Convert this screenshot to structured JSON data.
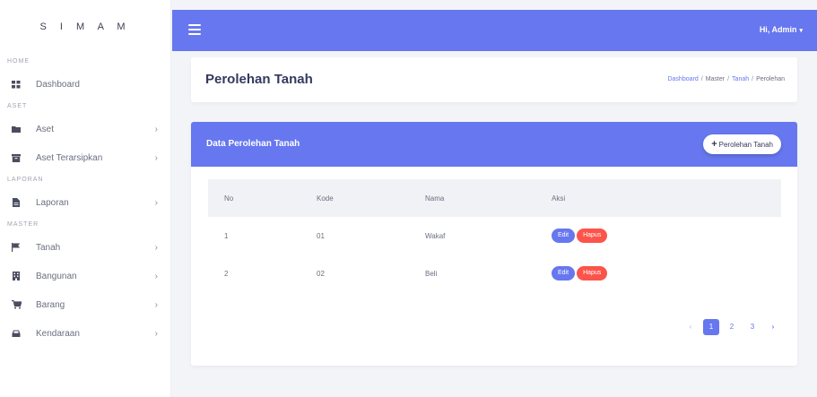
{
  "brand": "S I M A M",
  "topbar": {
    "user_label": "Hi, Admin",
    "caret": "▾"
  },
  "sidebar": {
    "sections": [
      "HOME",
      "ASET",
      "LAPORAN",
      "MASTER"
    ],
    "items": [
      {
        "label": "Dashboard",
        "icon": "dashboard-icon"
      },
      {
        "label": "Aset",
        "icon": "folder-icon"
      },
      {
        "label": "Aset Terarsipkan",
        "icon": "archive-icon"
      },
      {
        "label": "Laporan",
        "icon": "file-icon"
      },
      {
        "label": "Tanah",
        "icon": "flag-icon"
      },
      {
        "label": "Bangunan",
        "icon": "building-icon"
      },
      {
        "label": "Barang",
        "icon": "cart-icon"
      },
      {
        "label": "Kendaraan",
        "icon": "car-icon"
      }
    ],
    "chevron": "›"
  },
  "header": {
    "title": "Perolehan Tanah",
    "breadcrumb": [
      "Dashboard",
      "Master",
      "Tanah",
      "Perolehan"
    ],
    "sep": "/"
  },
  "card": {
    "title": "Data Perolehan Tanah",
    "add_button": "Perolehan Tanah",
    "plus": "+"
  },
  "table": {
    "columns": [
      "No",
      "Kode",
      "Nama",
      "Aksi"
    ],
    "rows": [
      {
        "no": "1",
        "kode": "01",
        "nama": "Wakaf"
      },
      {
        "no": "2",
        "kode": "02",
        "nama": "Beli"
      }
    ],
    "edit_label": "Edit",
    "delete_label": "Hapus"
  },
  "pagination": {
    "prev": "‹",
    "pages": [
      "1",
      "2",
      "3"
    ],
    "next": "›"
  },
  "colors": {
    "primary": "#6777ef",
    "danger": "#fc544b",
    "background": "#f3f4f8"
  }
}
